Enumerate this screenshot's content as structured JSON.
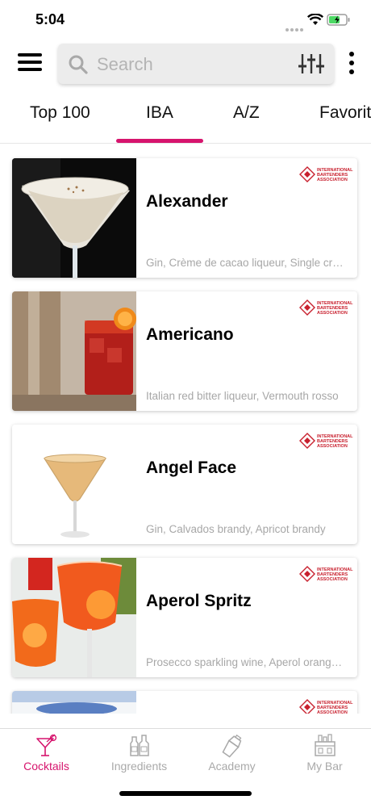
{
  "status_bar": {
    "time": "5:04"
  },
  "header": {
    "search_placeholder": "Search",
    "menu_icon": "hamburger-menu-icon",
    "filter_icon": "sliders-icon",
    "more_icon": "vertical-dots-icon"
  },
  "tabs": [
    {
      "label": "Top 100"
    },
    {
      "label": "IBA",
      "active": true
    },
    {
      "label": "A/Z"
    },
    {
      "label": "Favorites"
    }
  ],
  "cocktails": [
    {
      "name": "Alexander",
      "ingredients": "Gin, Crème de cacao liqueur, Single cream",
      "badge": "INTERNATIONAL BARTENDERS ASSOCIATION"
    },
    {
      "name": "Americano",
      "ingredients": "Italian red bitter liqueur, Vermouth rosso",
      "badge": "INTERNATIONAL BARTENDERS ASSOCIATION"
    },
    {
      "name": "Angel Face",
      "ingredients": "Gin, Calvados brandy, Apricot brandy",
      "badge": "INTERNATIONAL BARTENDERS ASSOCIATION"
    },
    {
      "name": "Aperol Spritz",
      "ingredients": "Prosecco sparkling wine, Aperol orange bitter",
      "badge": "INTERNATIONAL BARTENDERS ASSOCIATION"
    },
    {
      "name": "",
      "ingredients": "",
      "badge": "INTERNATIONAL BARTENDERS ASSOCIATION"
    }
  ],
  "bottom_nav": [
    {
      "label": "Cocktails",
      "icon": "cocktail-glass-icon",
      "active": true
    },
    {
      "label": "Ingredients",
      "icon": "bottles-icon"
    },
    {
      "label": "Academy",
      "icon": "shaker-icon"
    },
    {
      "label": "My Bar",
      "icon": "bar-counter-icon"
    }
  ],
  "colors": {
    "accent": "#d6146d",
    "iba_red": "#c8202e",
    "inactive": "#a9a9a9"
  }
}
